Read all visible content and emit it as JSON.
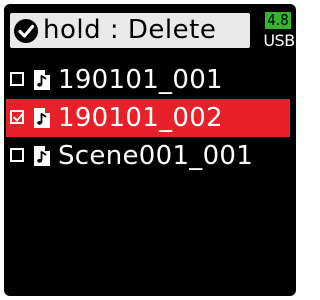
{
  "header": {
    "title": "hold : Delete",
    "check_icon": "check-circle-icon"
  },
  "status": {
    "battery_level": "4.8",
    "battery_color": "#2fb82f",
    "power_source": "USB"
  },
  "files": [
    {
      "name": "190101_001",
      "checked": false,
      "selected": false
    },
    {
      "name": "190101_002",
      "checked": true,
      "selected": true
    },
    {
      "name": "Scene001_001",
      "checked": false,
      "selected": false
    }
  ],
  "colors": {
    "selection": "#e8202a",
    "header_bg": "#e9e9e9"
  },
  "icons": {
    "file": "audio-file-icon",
    "checkbox": "checkbox-icon"
  }
}
